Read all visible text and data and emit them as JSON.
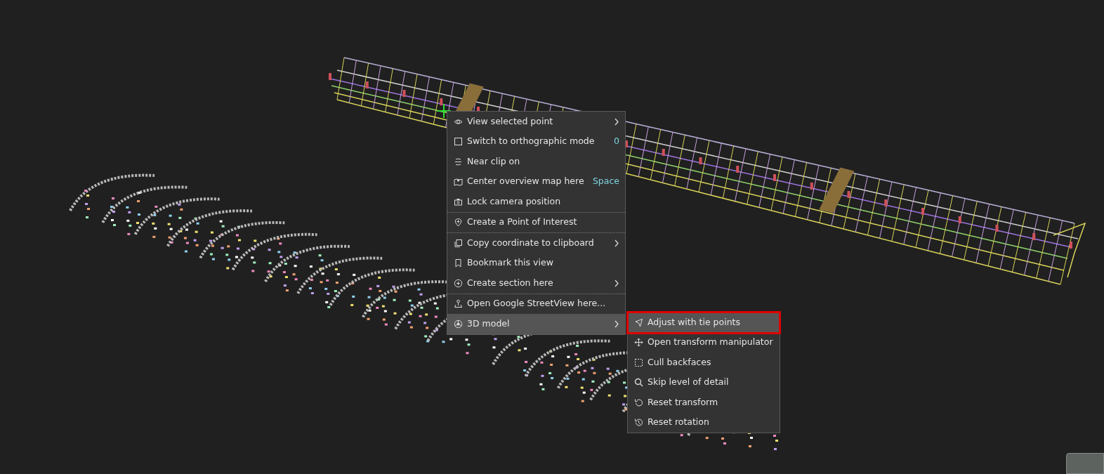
{
  "context_menu": {
    "sections": [
      [
        {
          "label": "View selected point",
          "has_submenu": true,
          "selected": false
        },
        {
          "label": "Switch to orthographic mode",
          "shortcut": "0",
          "has_submenu": false,
          "selected": false
        },
        {
          "label": "Near clip on",
          "has_submenu": false,
          "selected": false
        },
        {
          "label": "Center overview map here",
          "shortcut": "Space",
          "has_submenu": false,
          "selected": false
        },
        {
          "label": "Lock camera position",
          "has_submenu": false,
          "selected": false
        }
      ],
      [
        {
          "label": "Create a Point of Interest",
          "has_submenu": false,
          "selected": false
        }
      ],
      [
        {
          "label": "Copy coordinate to clipboard",
          "has_submenu": true,
          "selected": false
        },
        {
          "label": "Bookmark this view",
          "has_submenu": false,
          "selected": false
        },
        {
          "label": "Create section here",
          "has_submenu": true,
          "selected": false
        }
      ],
      [
        {
          "label": "Open Google StreetView here...",
          "has_submenu": false,
          "selected": false
        },
        {
          "label": "3D model",
          "has_submenu": true,
          "selected": true
        }
      ]
    ]
  },
  "submenu": {
    "items": [
      {
        "label": "Adjust with tie points",
        "selected": true,
        "outlined": true
      },
      {
        "label": "Open transform manipulator",
        "selected": false,
        "outlined": false
      },
      {
        "label": "Cull backfaces",
        "selected": false,
        "outlined": false
      },
      {
        "label": "Skip level of detail",
        "selected": false,
        "outlined": false
      },
      {
        "label": "Reset transform",
        "selected": false,
        "outlined": false
      },
      {
        "label": "Reset rotation",
        "selected": false,
        "outlined": false
      }
    ]
  }
}
